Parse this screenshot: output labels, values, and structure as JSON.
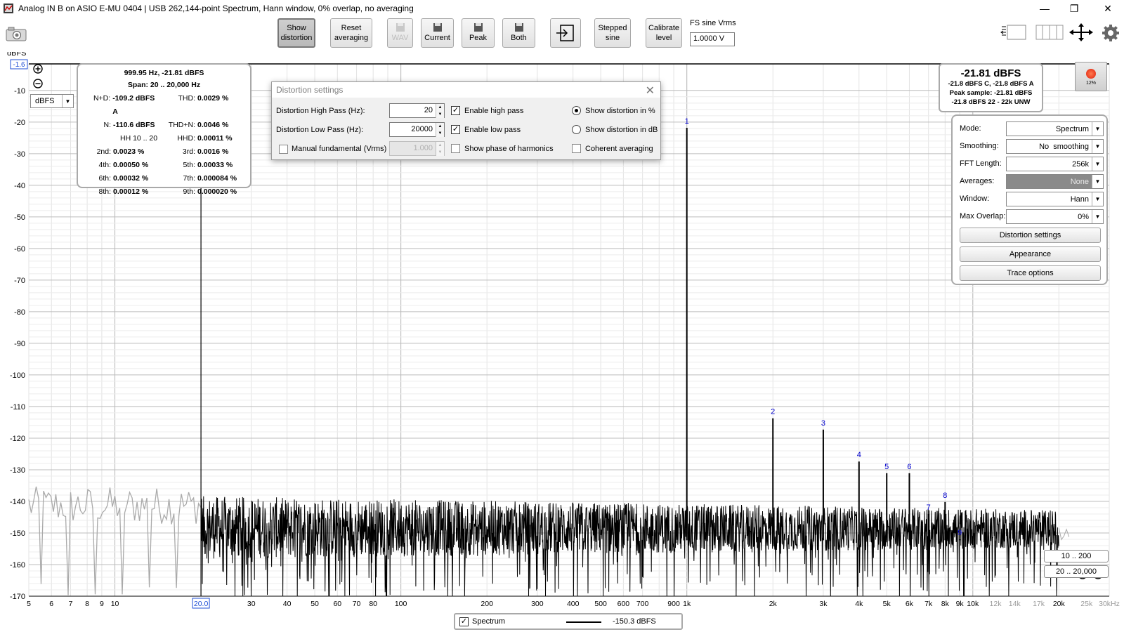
{
  "window": {
    "title": "Analog IN B on ASIO E-MU 0404 | USB 262,144-point Spectrum, Hann window, 0% overlap, no averaging",
    "minimize": "—",
    "maximize": "❐",
    "close": "✕"
  },
  "toolbar": {
    "show_distortion": [
      "Show",
      "distortion"
    ],
    "reset_averaging": [
      "Reset",
      "averaging"
    ],
    "wav": "WAV",
    "current": "Current",
    "peak": "Peak",
    "both": "Both",
    "stepped_sine": [
      "Stepped",
      "sine"
    ],
    "calibrate_level": [
      "Calibrate",
      "level"
    ],
    "fs_label": "FS sine Vrms",
    "fs_value": "1.0000 V",
    "icons": [
      "camera-icon",
      "layout-icon",
      "columns-icon",
      "expand-icon",
      "gear-icon",
      "export-icon",
      "disk-icon"
    ]
  },
  "plot": {
    "y_unit_label": "dBFS",
    "y_top_value": "-1.6",
    "unit_select": "dBFS",
    "y_ticks": [
      "-10",
      "-20",
      "-30",
      "-40",
      "-50",
      "-60",
      "-70",
      "-80",
      "-90",
      "-100",
      "-110",
      "-120",
      "-130",
      "-140",
      "-150",
      "-160",
      "-170"
    ],
    "x_ticks": [
      "5",
      "6",
      "7",
      "8",
      "9",
      "10",
      "20.0",
      "30",
      "40",
      "50",
      "60",
      "70",
      "80",
      "100",
      "200",
      "300",
      "400",
      "500",
      "600",
      "700",
      "900",
      "1k",
      "2k",
      "3k",
      "4k",
      "5k",
      "6k",
      "7k",
      "8k",
      "9k",
      "10k",
      "12k",
      "14k",
      "17k",
      "20k",
      "25k",
      "30kHz"
    ],
    "harmonic_labels": [
      "1",
      "2",
      "3",
      "4",
      "5",
      "6",
      "7",
      "8",
      "9"
    ],
    "range_buttons": [
      "10 .. 200",
      "20 .. 20,000"
    ]
  },
  "chart_data": {
    "type": "line",
    "title": "",
    "xlabel": "",
    "ylabel": "dBFS",
    "x_scale": "log",
    "xlim": [
      5,
      30000
    ],
    "ylim": [
      -170,
      -1.6
    ],
    "analysis_range_hz": [
      20,
      20000
    ],
    "noise_floor_dbfs": -150.3,
    "series": [
      {
        "name": "Spectrum",
        "color": "#000000"
      }
    ],
    "harmonics": [
      {
        "label": "1",
        "freq_hz": 1000,
        "dbfs": -21.81
      },
      {
        "label": "2",
        "freq_hz": 2000,
        "dbfs": -113.7
      },
      {
        "label": "3",
        "freq_hz": 3000,
        "dbfs": -117.3
      },
      {
        "label": "4",
        "freq_hz": 4000,
        "dbfs": -127.4
      },
      {
        "label": "5",
        "freq_hz": 5000,
        "dbfs": -131.1
      },
      {
        "label": "6",
        "freq_hz": 6000,
        "dbfs": -131.1
      },
      {
        "label": "7",
        "freq_hz": 7000,
        "dbfs": -144.0
      },
      {
        "label": "8",
        "freq_hz": 8000,
        "dbfs": -140.2
      },
      {
        "label": "9",
        "freq_hz": 9000,
        "dbfs": -152.0
      }
    ]
  },
  "info": {
    "header": "999.95 Hz, -21.81 dBFS",
    "span": "Span: 20 .. 20,000 Hz",
    "rows": [
      {
        "lk": "N+D:",
        "lv": "-109.2 dBFS A",
        "rk": "THD:",
        "rv": "0.0029 %"
      },
      {
        "lk": "N:",
        "lv": "-110.6 dBFS",
        "rk": "THD+N:",
        "rv": "0.0046 %"
      },
      {
        "lk": "",
        "lv": "HH 10 .. 20",
        "rk": "HHD:",
        "rv": "0.00011 %"
      },
      {
        "lk": "2nd:",
        "lv": "0.0023 %",
        "rk": "3rd:",
        "rv": "0.0016 %"
      },
      {
        "lk": "4th:",
        "lv": "0.00050 %",
        "rk": "5th:",
        "rv": "0.00033 %"
      },
      {
        "lk": "6th:",
        "lv": "0.00032 %",
        "rk": "7th:",
        "rv": "0.000084 %"
      },
      {
        "lk": "8th:",
        "lv": "0.00012 %",
        "rk": "9th:",
        "rv": "0.000020 %"
      }
    ]
  },
  "dialog": {
    "title": "Distortion settings",
    "hp_label": "Distortion High Pass (Hz):",
    "hp_value": "20",
    "lp_label": "Distortion Low Pass (Hz):",
    "lp_value": "20000",
    "manual_label": "Manual fundamental (Vrms)",
    "manual_value": "1.000",
    "enable_hp": "Enable high pass",
    "enable_lp": "Enable low pass",
    "show_phase": "Show phase of harmonics",
    "show_pct": "Show distortion in %",
    "show_db": "Show distortion in dB",
    "coherent": "Coherent averaging",
    "check": "✓"
  },
  "readout": {
    "big": "-21.81 dBFS",
    "line1": "-21.8 dBFS C, -21.8 dBFS A",
    "line2": "Peak sample: -21.81 dBFS",
    "line3": "-21.8 dBFS 22 - 22k UNW",
    "rec_pct": "12%"
  },
  "settings": {
    "mode_label": "Mode:",
    "mode_value": "Spectrum",
    "smoothing_label": "Smoothing:",
    "smoothing_value": "No  smoothing",
    "fft_label": "FFT Length:",
    "fft_value": "256k",
    "averages_label": "Averages:",
    "averages_value": "None",
    "window_label": "Window:",
    "window_value": "Hann",
    "overlap_label": "Max Overlap:",
    "overlap_value": "0%",
    "distortion_settings": "Distortion settings",
    "appearance": "Appearance",
    "trace_options": "Trace options"
  },
  "legend": {
    "series": "Spectrum",
    "value": "-150.3 dBFS"
  }
}
